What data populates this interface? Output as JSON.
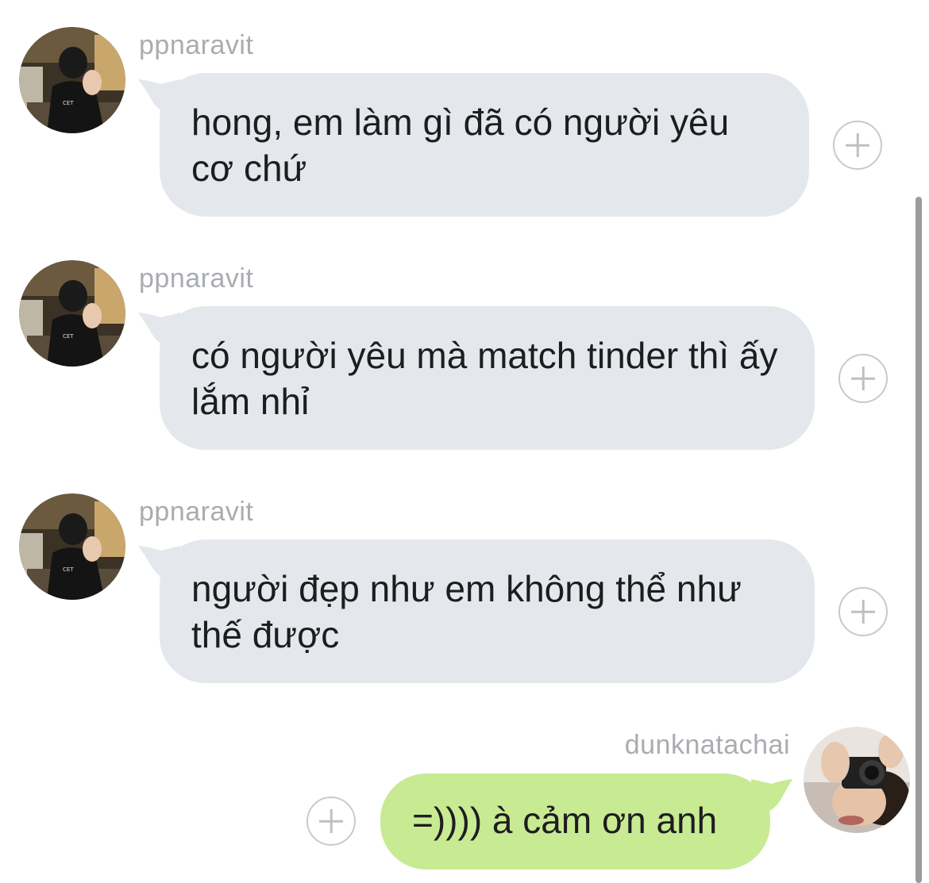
{
  "colors": {
    "incoming_bubble": "#e4e8ec",
    "outgoing_bubble": "#c8ea93",
    "sender_name": "#a9acb0",
    "plus_icon": "#c9c9cc"
  },
  "messages": [
    {
      "direction": "incoming",
      "sender": "ppnaravit",
      "text": "hong, em làm gì đã có người yêu cơ chứ",
      "action_icon": "plus-circle-icon"
    },
    {
      "direction": "incoming",
      "sender": "ppnaravit",
      "text": "có người yêu mà match tinder thì ấy lắm nhỉ",
      "action_icon": "plus-circle-icon"
    },
    {
      "direction": "incoming",
      "sender": "ppnaravit",
      "text": "người đẹp như em không thể như thế được",
      "action_icon": "plus-circle-icon"
    },
    {
      "direction": "outgoing",
      "sender": "dunknatachai",
      "text": "=)))) à cảm ơn anh",
      "action_icon": "plus-circle-icon"
    }
  ]
}
